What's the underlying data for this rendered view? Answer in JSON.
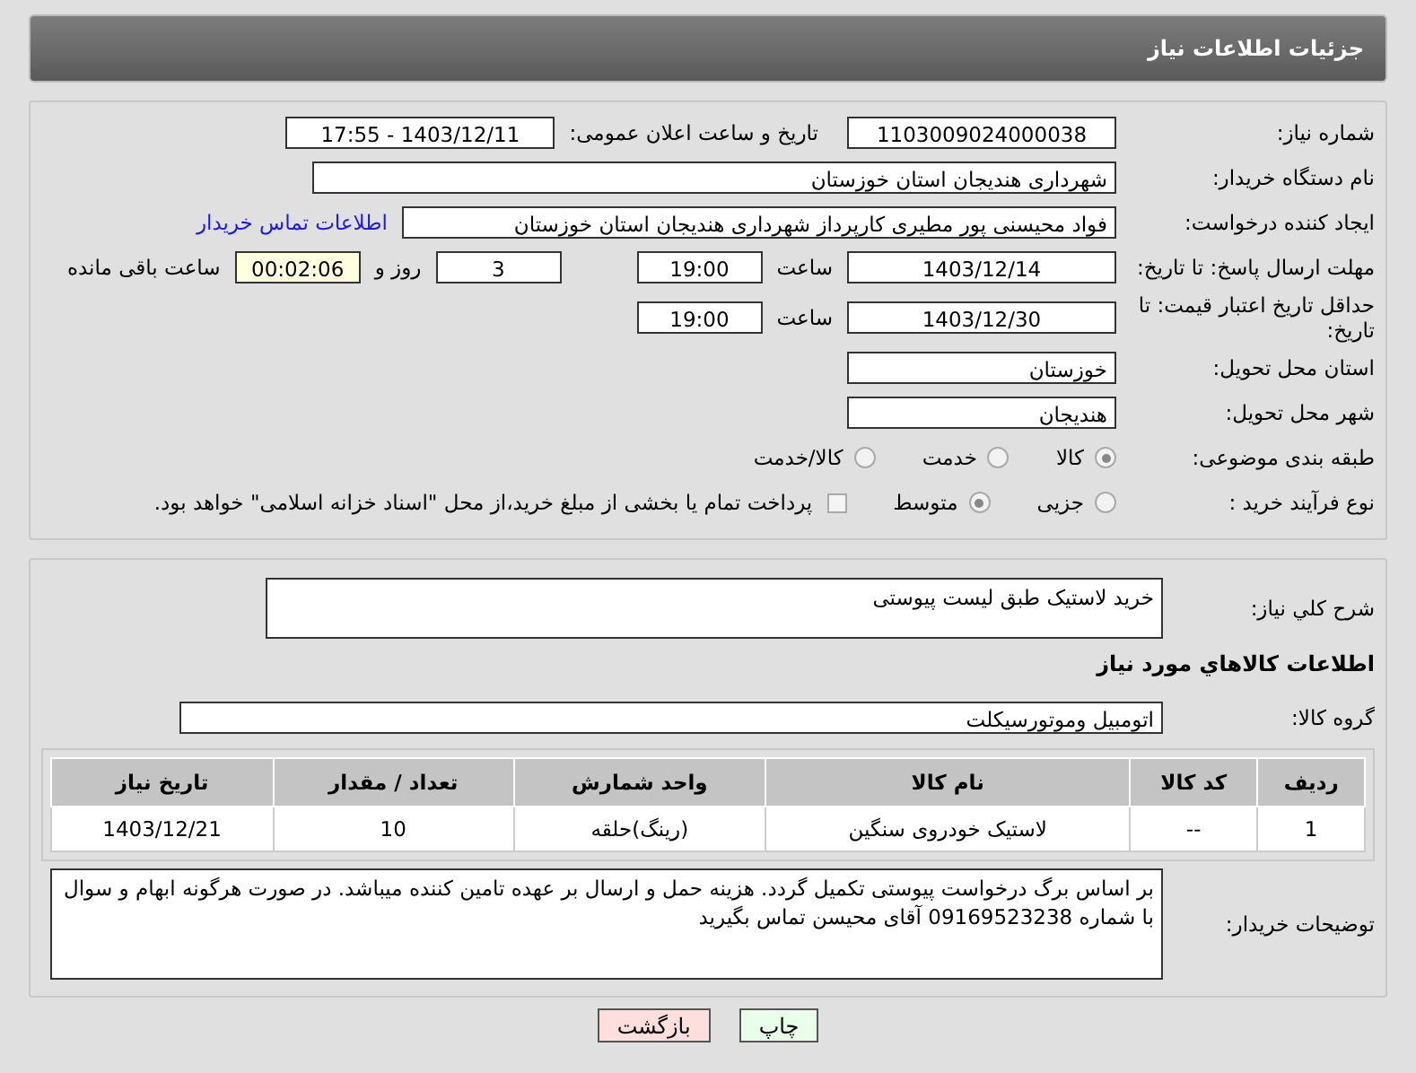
{
  "header": {
    "title": "جزئیات اطلاعات نیاز"
  },
  "need_number": {
    "label": "شماره نیاز:",
    "value": "1103009024000038"
  },
  "announce": {
    "label": "تاریخ و ساعت اعلان عمومی:",
    "value": "1403/12/11 - 17:55"
  },
  "buyer_org": {
    "label": "نام دستگاه خریدار:",
    "value": "شهرداری هندیجان استان خوزستان"
  },
  "requester": {
    "label": "ایجاد کننده درخواست:",
    "value": "فواد محیسنی پور مطیری کارپرداز شهرداری هندیجان استان خوزستان",
    "link": "اطلاعات تماس خریدار"
  },
  "reply_deadline": {
    "label": "مهلت ارسال پاسخ: تا تاریخ:",
    "date": "1403/12/14",
    "time_label": "ساعت",
    "time": "19:00",
    "days": "3",
    "days_label": "روز و",
    "remaining": "00:02:06",
    "remaining_label": "ساعت باقی مانده"
  },
  "price_validity": {
    "label": "حداقل تاریخ اعتبار قیمت: تا تاریخ:",
    "date": "1403/12/30",
    "time_label": "ساعت",
    "time": "19:00"
  },
  "province": {
    "label": "استان محل تحویل:",
    "value": "خوزستان"
  },
  "city": {
    "label": "شهر محل تحویل:",
    "value": "هندیجان"
  },
  "category": {
    "label": "طبقه بندی موضوعی:",
    "options": [
      {
        "label": "كالا",
        "selected": true
      },
      {
        "label": "خدمت",
        "selected": false
      },
      {
        "label": "كالا/خدمت",
        "selected": false
      }
    ]
  },
  "process": {
    "label": "نوع فرآیند خرید :",
    "options": [
      {
        "label": "جزیی",
        "selected": false
      },
      {
        "label": "متوسط",
        "selected": true
      }
    ],
    "payment": {
      "label": "پرداخت تمام یا بخشی از مبلغ خرید،از محل \"اسناد خزانه اسلامی\" خواهد بود.",
      "checked": false
    }
  },
  "summary": {
    "label": "شرح كلي نياز:",
    "value": "خرید لاستیک طبق لیست پیوستی"
  },
  "goods_title": "اطلاعات كالاهاي مورد نياز",
  "goods_group": {
    "label": "گروه كالا:",
    "value": "اتومبیل وموتورسیکلت"
  },
  "table": {
    "columns": [
      "رديف",
      "كد كالا",
      "نام كالا",
      "واحد شمارش",
      "تعداد / مقدار",
      "تاريخ نياز"
    ],
    "rows": [
      [
        "1",
        "--",
        "لاستیک خودروی سنگین",
        "(رینگ)حلقه",
        "10",
        "1403/12/21"
      ]
    ]
  },
  "buyer_notes": {
    "label": "توضیحات خریدار:",
    "value": "بر اساس برگ درخواست پیوستی تکمیل گردد. هزینه حمل و ارسال بر عهده تامین کننده میباشد. در صورت هرگونه ابهام و سوال با شماره 09169523238 آقای محیسن تماس بگیرید"
  },
  "buttons": [
    {
      "label": "چاپ",
      "kind": "print"
    },
    {
      "label": "بازگشت",
      "kind": "back"
    }
  ]
}
